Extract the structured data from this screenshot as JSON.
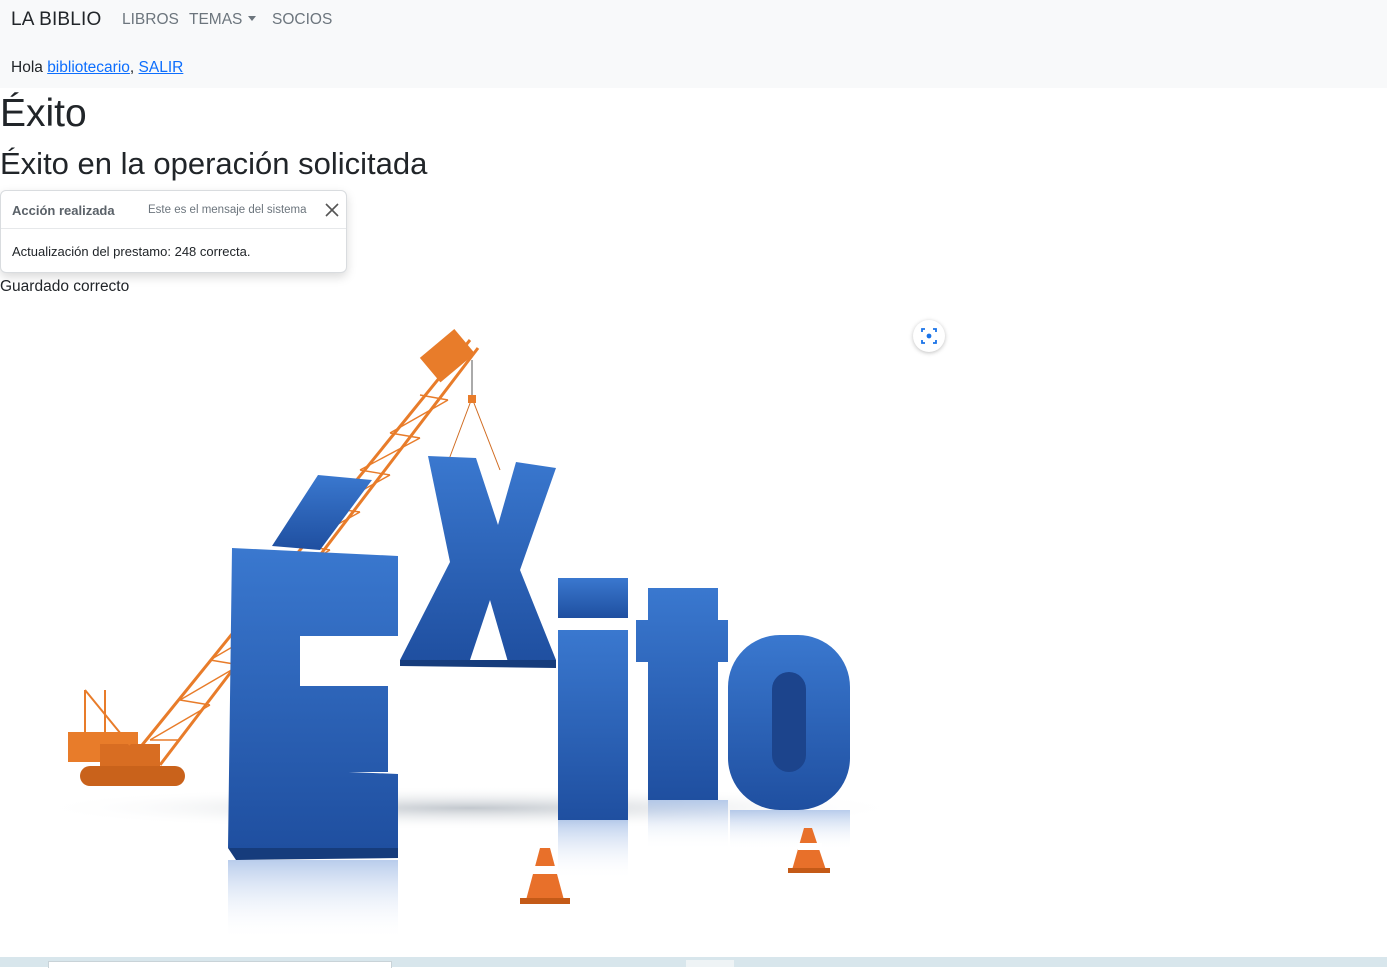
{
  "navbar": {
    "brand": "LA BIBLIO",
    "links": [
      {
        "label": "LIBROS"
      },
      {
        "label": "TEMAS"
      },
      {
        "label": "SOCIOS"
      }
    ],
    "greeting_prefix": "Hola ",
    "user_link": "bibliotecario",
    "separator": ",",
    "logout_link": "SALIR"
  },
  "page": {
    "title": "Éxito",
    "subtitle": "Éxito en la operación solicitada",
    "saved_text": "Guardado correcto"
  },
  "toast": {
    "title": "Acción realizada",
    "meta": "Este es el mensaje del sistema",
    "body": "Actualización del prestamo: 248 correcta."
  },
  "illustration": {
    "text": "Éxito",
    "color": "#2e63b8",
    "crane_color": "#e87c2a"
  },
  "icons": {
    "close": "close-icon",
    "caret": "caret-down-icon",
    "lens": "visual-search-icon"
  }
}
